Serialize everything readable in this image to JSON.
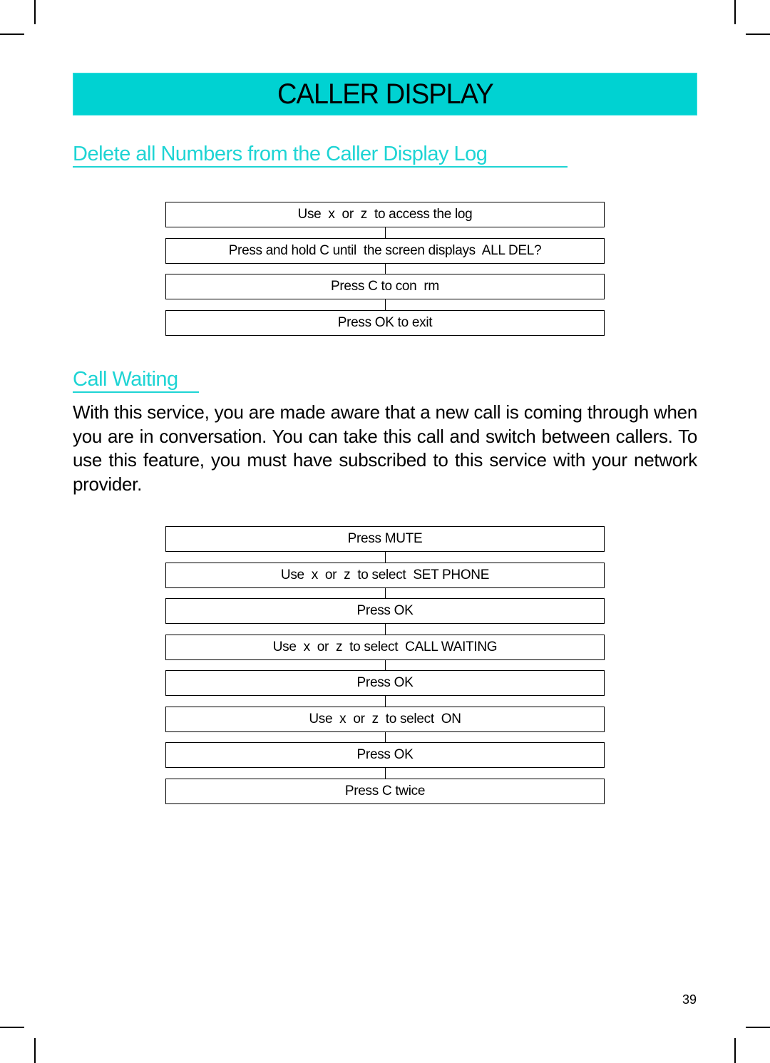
{
  "page": {
    "banner_title": "CALLER DISPLAY",
    "page_number": "39",
    "accent_color": "#00d2d2"
  },
  "section_delete": {
    "heading": "Delete all Numbers from the Caller Display Log",
    "steps": [
      "Use  x  or  z  to access the log",
      "Press and hold C until  the screen displays  ALL DEL?",
      "Press C to con  rm",
      "Press OK to exit"
    ]
  },
  "section_call_waiting": {
    "heading": "Call Waiting",
    "paragraph": "With this service, you are made aware that a new call is coming through when you are in conversation. You can take this call and switch between callers. To use this feature, you must have subscribed to this service with your network provider.",
    "steps": [
      "Press MUTE",
      "Use  x  or  z  to select  SET PHONE",
      "Press OK",
      "Use  x  or  z  to select  CALL WAITING",
      "Press OK",
      "Use  x  or  z  to select  ON",
      "Press OK",
      "Press C twice"
    ]
  }
}
